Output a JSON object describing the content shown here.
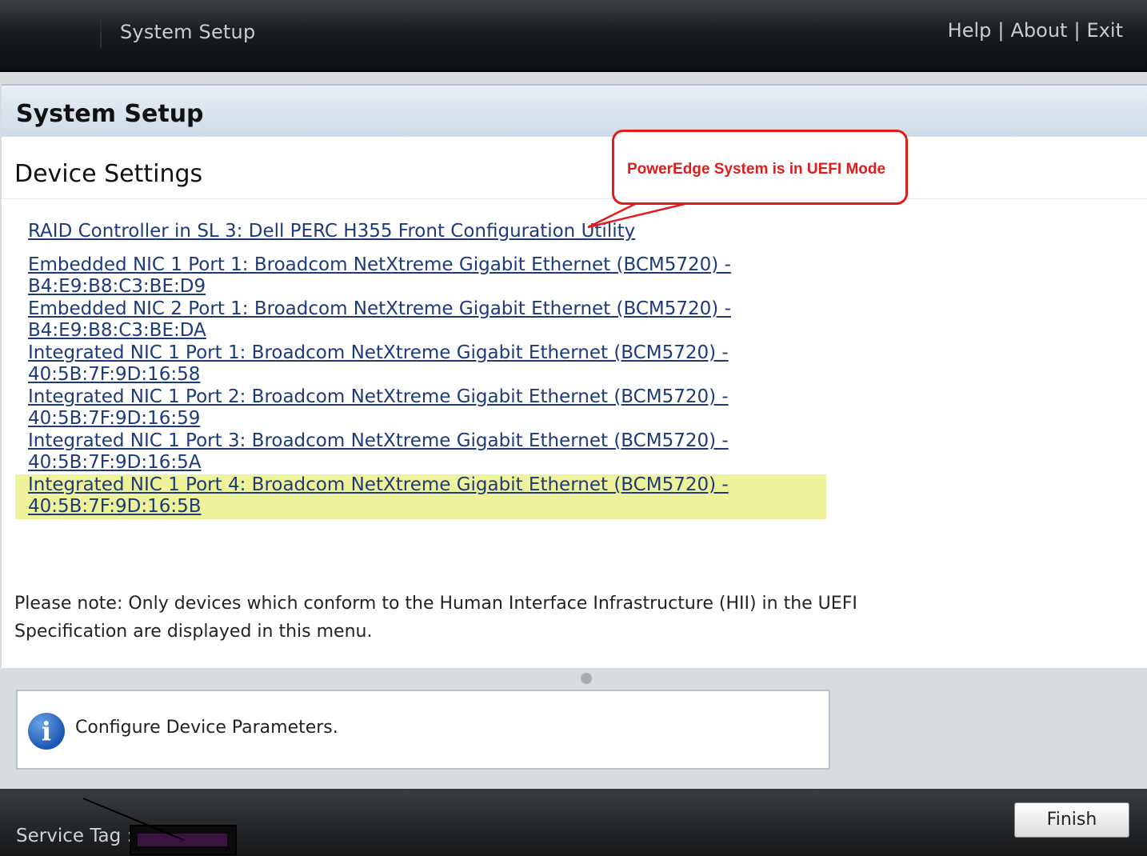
{
  "topbar": {
    "title": "System Setup",
    "links": [
      "Help",
      "About",
      "Exit"
    ],
    "separator": "|"
  },
  "page": {
    "header": "System Setup",
    "section_title": "Device Settings"
  },
  "devices": [
    {
      "line1": "RAID Controller in SL 3: Dell PERC H355 Front Configuration Utility",
      "line2": ""
    },
    {
      "line1": "Embedded NIC 1 Port 1: Broadcom NetXtreme Gigabit Ethernet (BCM5720) -",
      "line2": "B4:E9:B8:C3:BE:D9"
    },
    {
      "line1": "Embedded NIC 2 Port 1: Broadcom NetXtreme Gigabit Ethernet (BCM5720) -",
      "line2": "B4:E9:B8:C3:BE:DA"
    },
    {
      "line1": "Integrated NIC 1 Port 1: Broadcom NetXtreme Gigabit Ethernet (BCM5720) -",
      "line2": "40:5B:7F:9D:16:58"
    },
    {
      "line1": "Integrated NIC 1 Port 2: Broadcom NetXtreme Gigabit Ethernet (BCM5720) -",
      "line2": "40:5B:7F:9D:16:59"
    },
    {
      "line1": "Integrated NIC 1 Port 3: Broadcom NetXtreme Gigabit Ethernet (BCM5720) -",
      "line2": "40:5B:7F:9D:16:5A"
    },
    {
      "line1": "Integrated NIC 1 Port 4: Broadcom NetXtreme Gigabit Ethernet (BCM5720) -",
      "line2": "40:5B:7F:9D:16:5B"
    }
  ],
  "selected_device_index": 6,
  "note": {
    "line1": "Please note: Only devices which conform to the Human Interface Infrastructure (HII) in the UEFI",
    "line2": "Specification are displayed in this menu."
  },
  "callout": {
    "text": "PowerEdge System is in UEFI Mode",
    "color": "#e21b1b"
  },
  "info": {
    "icon": "info-icon",
    "message": "Configure Device Parameters."
  },
  "footer": {
    "service_tag_label": "Service Tag :",
    "finish_label": "Finish"
  },
  "colors": {
    "link": "#1d3a7a",
    "highlight": "#eef29a"
  }
}
